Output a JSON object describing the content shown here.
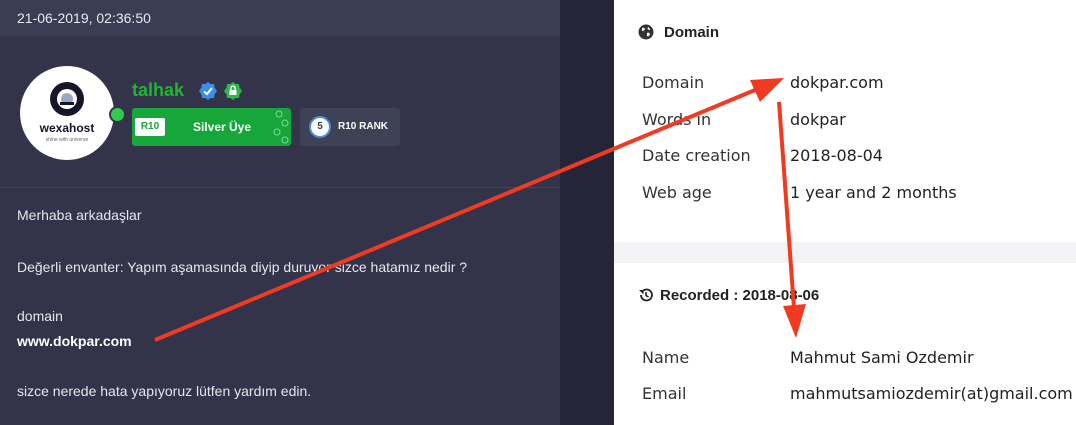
{
  "post": {
    "timestamp": "21-06-2019, 02:36:50",
    "avatar": {
      "brand": "wexahost",
      "tagline": "shine with universe"
    },
    "user": {
      "name": "talhak"
    },
    "badge": {
      "code": "R10",
      "label": "Silver Üye"
    },
    "rank": {
      "number": "5",
      "label": "R10 RANK"
    },
    "message": {
      "greeting": "Merhaba arkadaşlar",
      "question": "Değerli envanter: Yapım aşamasında diyip duruyor sizce hatamız nedir ?",
      "domain_label": "domain",
      "domain_url": "www.dokpar.com",
      "closing": "sizce nerede hata yapıyoruz lütfen yardım edin."
    }
  },
  "whois": {
    "domain_card": {
      "title": "Domain",
      "rows": [
        {
          "label": "Domain",
          "value": "dokpar.com"
        },
        {
          "label": "Words in",
          "value": "dokpar"
        },
        {
          "label": "Date creation",
          "value": "2018-08-04"
        },
        {
          "label": "Web age",
          "value": "1 year and 2 months"
        }
      ]
    },
    "recorded_card": {
      "title": "Recorded : 2018-08-06",
      "rows": [
        {
          "label": "Name",
          "value": "Mahmut Sami Ozdemir"
        },
        {
          "label": "Email",
          "value": "mahmutsamiozdemir(at)gmail.com"
        }
      ]
    }
  },
  "colors": {
    "username": "#21b432",
    "badge_green": "#16a63a",
    "arrow_red": "#f03a22",
    "forum_bg": "#33344a"
  }
}
